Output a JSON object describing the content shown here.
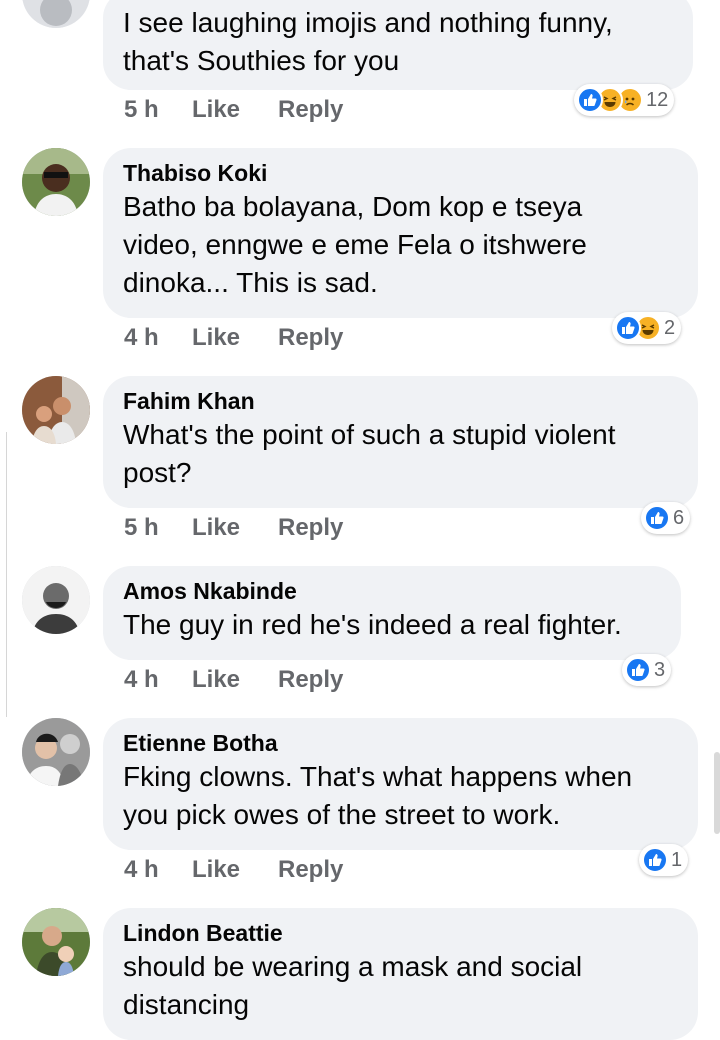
{
  "comments": [
    {
      "author": "",
      "text": "I see laughing imojis and nothing funny,\nthat's Southies for you",
      "time": "5 h",
      "like_label": "Like",
      "reply_label": "Reply",
      "reactions": [
        "like-icon",
        "haha-icon",
        "sad-icon"
      ],
      "reaction_count": "12"
    },
    {
      "author": "Thabiso Koki",
      "text": "Batho ba bolayana, Dom kop e tseya\nvideo, enngwe e eme Fela o itshwere\ndinoka... This is sad.",
      "time": "4 h",
      "like_label": "Like",
      "reply_label": "Reply",
      "reactions": [
        "like-icon",
        "haha-icon"
      ],
      "reaction_count": "2"
    },
    {
      "author": "Fahim Khan",
      "text": "What's the point of such a stupid violent\npost?",
      "time": "5 h",
      "like_label": "Like",
      "reply_label": "Reply",
      "reactions": [
        "like-icon"
      ],
      "reaction_count": "6"
    },
    {
      "author": "Amos Nkabinde",
      "text": "The guy in red he's indeed a real fighter.",
      "time": "4 h",
      "like_label": "Like",
      "reply_label": "Reply",
      "reactions": [
        "like-icon"
      ],
      "reaction_count": "3"
    },
    {
      "author": "Etienne Botha",
      "text": "Fking clowns. That's what happens when\nyou pick owes of the street to work.",
      "time": "4 h",
      "like_label": "Like",
      "reply_label": "Reply",
      "reactions": [
        "like-icon"
      ],
      "reaction_count": "1"
    },
    {
      "author": "Lindon Beattie",
      "text": "should be wearing a mask and social\ndistancing",
      "time": "",
      "like_label": "",
      "reply_label": "",
      "reactions": [],
      "reaction_count": ""
    }
  ],
  "colors": {
    "like_blue": "#1877f2",
    "haha_yellow": "#f7b125",
    "bubble_bg": "#f0f2f5",
    "meta_gray": "#65676b"
  }
}
